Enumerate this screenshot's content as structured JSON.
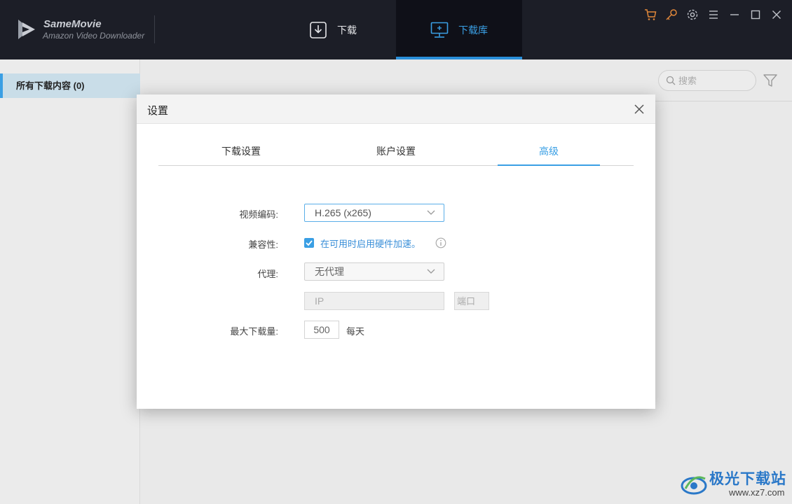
{
  "app": {
    "name": "SameMovie",
    "subtitle": "Amazon Video Downloader"
  },
  "nav": {
    "download_label": "下载",
    "library_label": "下载库",
    "active": "library"
  },
  "window_controls": [
    "cart-icon",
    "key-icon",
    "gear-icon",
    "menu-icon",
    "minimize-icon",
    "maximize-icon",
    "close-icon"
  ],
  "colors": {
    "accent": "#3a9fe4",
    "topbar": "#1c1e27",
    "cart_key": "#e0873a"
  },
  "sidebar": {
    "items": [
      {
        "label": "所有下载内容 (0)",
        "active": true
      }
    ]
  },
  "toolbar": {
    "search_placeholder": "搜索"
  },
  "settings_dialog": {
    "title": "设置",
    "tabs": [
      {
        "label": "下载设置"
      },
      {
        "label": "账户设置"
      },
      {
        "label": "高级",
        "active": true
      }
    ],
    "video_codec": {
      "label": "视频编码:",
      "value": "H.265 (x265)"
    },
    "compatibility": {
      "label": "兼容性:",
      "checkbox_label": "在可用时启用硬件加速。",
      "checked": true
    },
    "proxy": {
      "label": "代理:",
      "value": "无代理",
      "ip_placeholder": "IP",
      "port_placeholder": "端口"
    },
    "max_download": {
      "label": "最大下载量:",
      "value": "500",
      "unit": "每天"
    }
  },
  "watermark": {
    "text": "极光下载站",
    "url": "www.xz7.com"
  }
}
